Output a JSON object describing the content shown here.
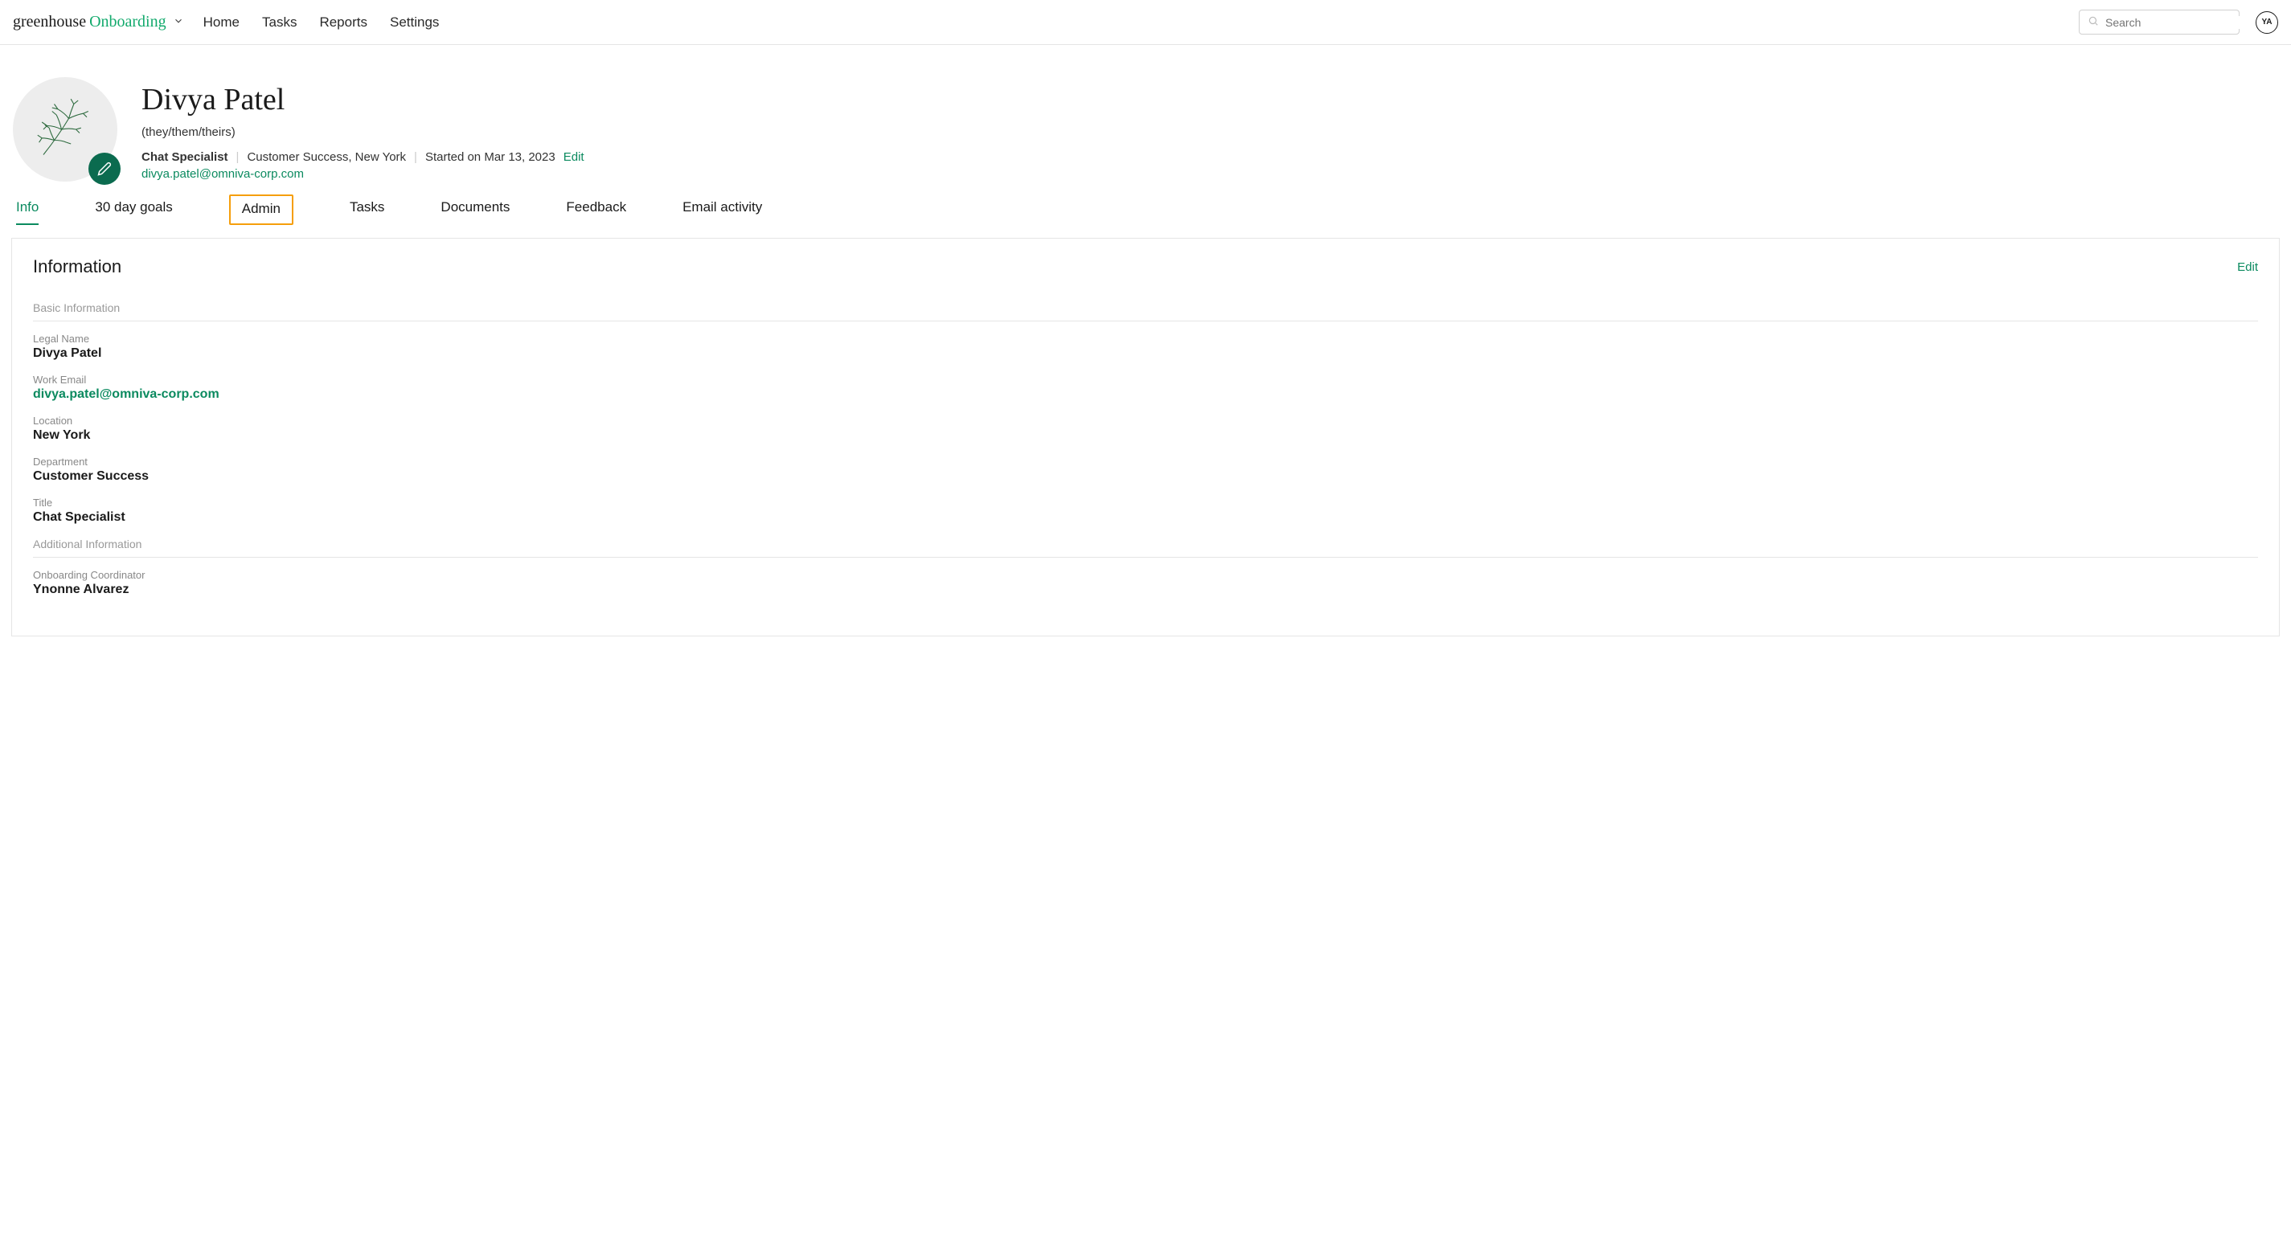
{
  "brand": {
    "main": "greenhouse",
    "sub": "Onboarding"
  },
  "nav": {
    "home": "Home",
    "tasks": "Tasks",
    "reports": "Reports",
    "settings": "Settings"
  },
  "search": {
    "placeholder": "Search"
  },
  "user_initials": "YA",
  "profile": {
    "name": "Divya Patel",
    "pronouns": "(they/them/theirs)",
    "title": "Chat Specialist",
    "department_location": "Customer Success, New York",
    "started_on": "Started on Mar 13, 2023",
    "edit_label": "Edit",
    "email": "divya.patel@omniva-corp.com"
  },
  "tabs": {
    "info": "Info",
    "goals": "30 day goals",
    "admin": "Admin",
    "tasks": "Tasks",
    "documents": "Documents",
    "feedback": "Feedback",
    "email_activity": "Email activity"
  },
  "panel": {
    "title": "Information",
    "edit": "Edit",
    "section_basic": "Basic Information",
    "section_additional": "Additional Information",
    "fields": {
      "legal_name_label": "Legal Name",
      "legal_name_value": "Divya Patel",
      "work_email_label": "Work Email",
      "work_email_value": "divya.patel@omniva-corp.com",
      "location_label": "Location",
      "location_value": "New York",
      "department_label": "Department",
      "department_value": "Customer Success",
      "title_label": "Title",
      "title_value": "Chat Specialist",
      "coordinator_label": "Onboarding Coordinator",
      "coordinator_value": "Ynonne Alvarez"
    }
  }
}
